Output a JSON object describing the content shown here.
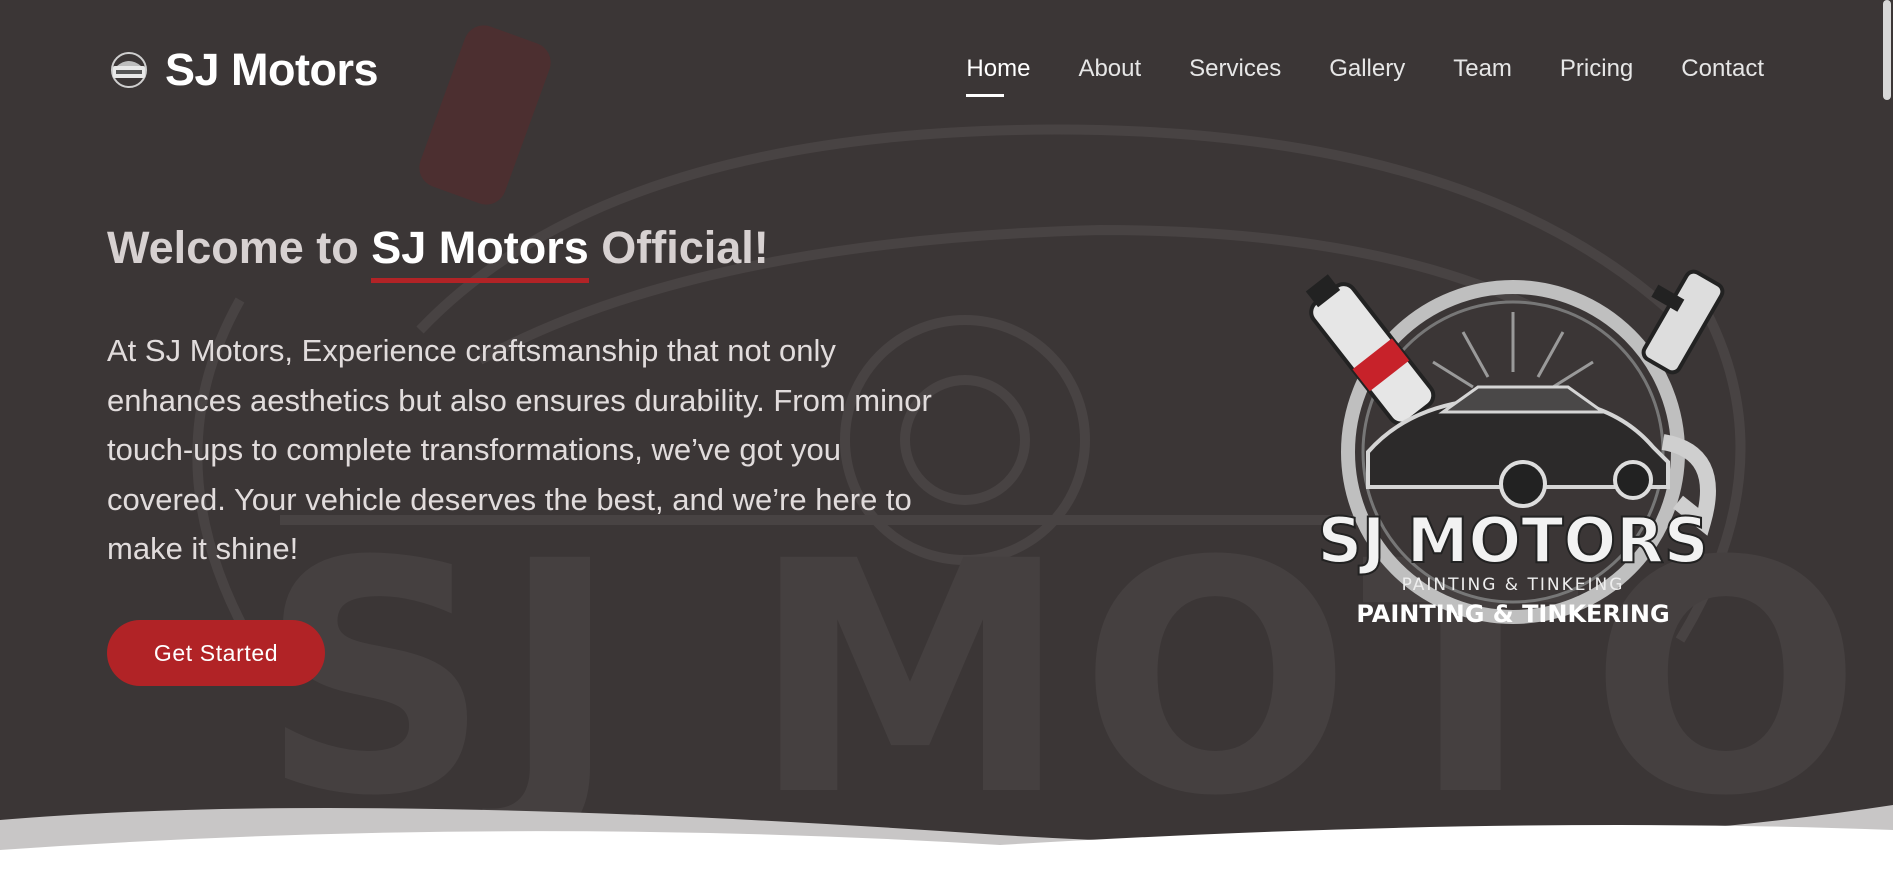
{
  "header": {
    "brand_name": "SJ Motors",
    "logo_icon": "sj-motors-logo-icon"
  },
  "nav": {
    "items": [
      {
        "label": "Home",
        "active": true
      },
      {
        "label": "About",
        "active": false
      },
      {
        "label": "Services",
        "active": false
      },
      {
        "label": "Gallery",
        "active": false
      },
      {
        "label": "Team",
        "active": false
      },
      {
        "label": "Pricing",
        "active": false
      },
      {
        "label": "Contact",
        "active": false
      }
    ]
  },
  "hero": {
    "title_prefix": "Welcome to ",
    "title_highlight": "SJ Motors",
    "title_suffix": " Official!",
    "description": "At SJ Motors, Experience craftsmanship that not only enhances aesthetics but also ensures durability. From minor touch-ups to complete transformations, we’ve got you covered. Your vehicle deserves the best, and we’re here to make it shine!",
    "cta_label": "Get Started"
  },
  "emblem": {
    "line1": "SJ MOTORS",
    "line2": "PAINTING & TINKEING",
    "line3": "PAINTING & TINKERING"
  },
  "colors": {
    "background": "#3b3636",
    "accent": "#b12326",
    "text": "#ffffff"
  }
}
